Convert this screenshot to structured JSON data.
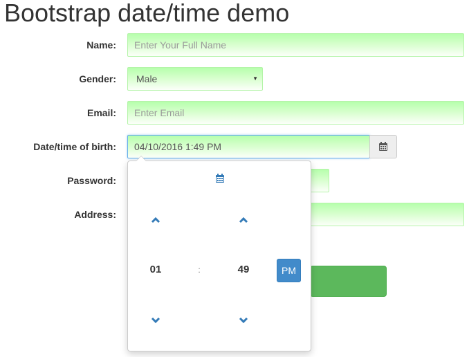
{
  "page": {
    "title": "Bootstrap date/time demo"
  },
  "form": {
    "name": {
      "label": "Name:",
      "placeholder": "Enter Your Full Name",
      "value": ""
    },
    "gender": {
      "label": "Gender:",
      "selected": "Male"
    },
    "email": {
      "label": "Email:",
      "placeholder": "Enter Email",
      "value": ""
    },
    "dob": {
      "label": "Date/time of birth:",
      "value": "04/10/2016 1:49 PM",
      "button_icon": "calendar-icon"
    },
    "password": {
      "label": "Password:"
    },
    "address": {
      "label": "Address:"
    }
  },
  "picker": {
    "header_icon": "calendar-icon",
    "hour": "01",
    "separator": ":",
    "minute": "49",
    "period": "PM",
    "up_icon": "chevron-up-icon",
    "down_icon": "chevron-down-icon"
  },
  "colors": {
    "field_gradient_top": "#b6ffac",
    "focus_border": "#66afe9",
    "primary": "#428bca",
    "success": "#5cb85c",
    "icon_blue": "#337ab7"
  }
}
